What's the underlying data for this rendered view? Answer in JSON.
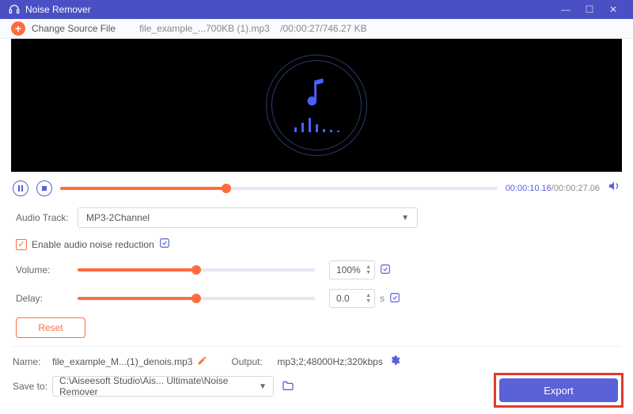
{
  "titlebar": {
    "title": "Noise Remover"
  },
  "toolbar": {
    "change_source": "Change Source File",
    "file_name": "file_example_...700KB (1).mp3",
    "sep": "/",
    "duration": "00:00:27",
    "size": "746.27 KB"
  },
  "playback": {
    "current": "00:00:10.16",
    "sep": "/",
    "total": "00:00:27.06"
  },
  "audio_track": {
    "label": "Audio Track:",
    "value": "MP3-2Channel"
  },
  "noise": {
    "label": "Enable audio noise reduction"
  },
  "volume": {
    "label": "Volume:",
    "value": "100%"
  },
  "delay": {
    "label": "Delay:",
    "value": "0.0",
    "unit": "s"
  },
  "reset": {
    "label": "Reset"
  },
  "output_name": {
    "label": "Name:",
    "value": "file_example_M...(1)_denois.mp3"
  },
  "output_fmt": {
    "label": "Output:",
    "value": "mp3;2;48000Hz;320kbps"
  },
  "save_to": {
    "label": "Save to:",
    "value": "C:\\Aiseesoft Studio\\Ais... Ultimate\\Noise Remover"
  },
  "export": {
    "label": "Export"
  }
}
